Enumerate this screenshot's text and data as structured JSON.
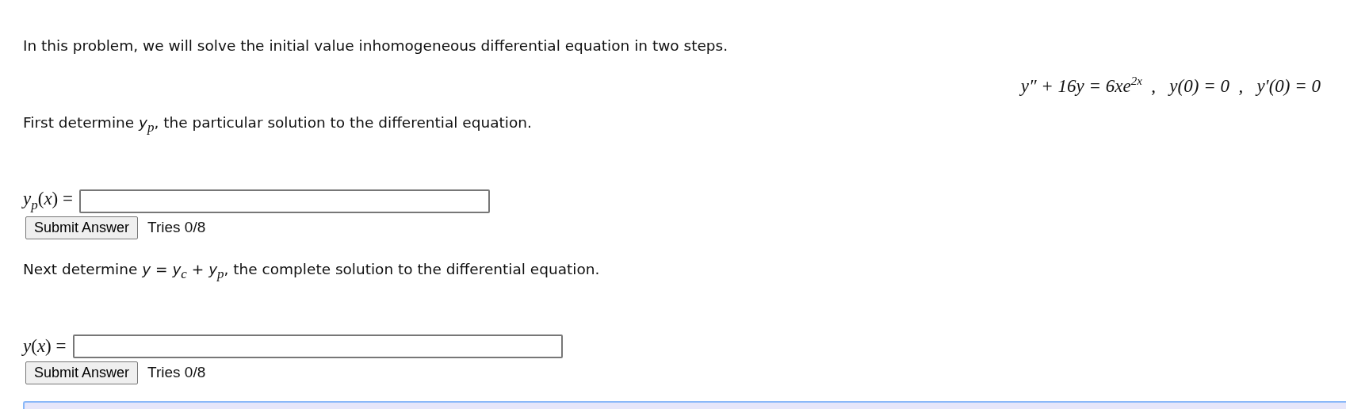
{
  "intro": "In this problem, we will solve the initial value inhomogeneous differential equation in two steps.",
  "equation": "y″ + 16y = 6xe$^{2x}$  ,   y(0) = 0  ,   y′(0) = 0",
  "steps": [
    {
      "prompt": "First determine *y*$_{p}$, the particular solution to the differential equation.",
      "label": "*y*$_{p}$(*x*) =",
      "button": "Submit Answer",
      "tries": "Tries 0/8"
    },
    {
      "prompt": "Next determine *y* = *y*$_{c}$ + *y*$_{p}$, the complete solution to the differential equation.",
      "label": "*y*(*x*) =",
      "button": "Submit Answer",
      "tries": "Tries 0/8"
    }
  ]
}
